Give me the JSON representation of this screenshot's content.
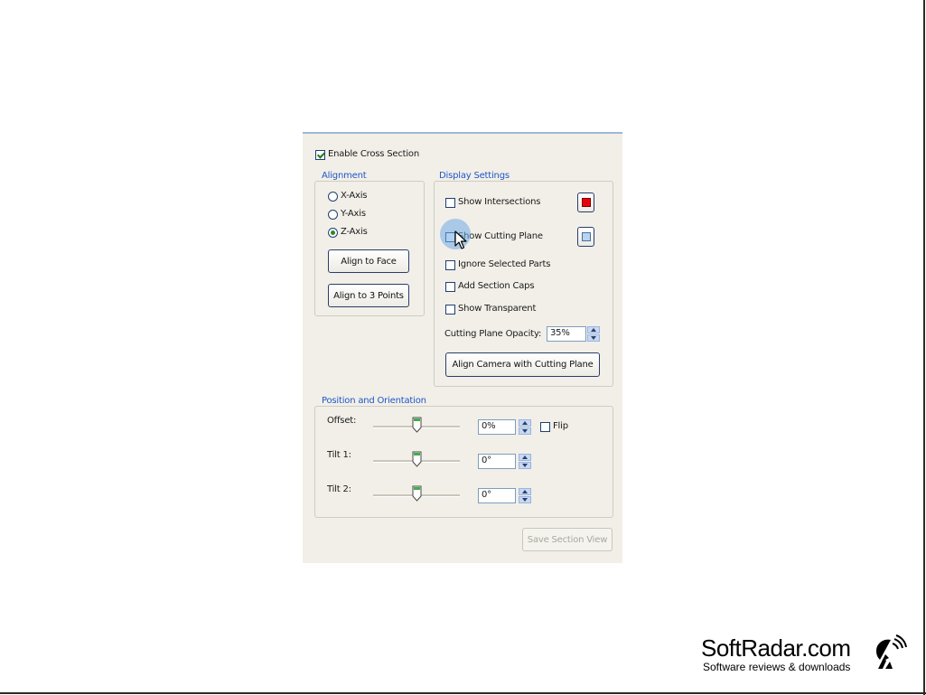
{
  "enable_cross_section": {
    "label": "Enable Cross Section",
    "checked": true
  },
  "alignment": {
    "title": "Alignment",
    "options": [
      {
        "label": "X-Axis",
        "selected": false
      },
      {
        "label": "Y-Axis",
        "selected": false
      },
      {
        "label": "Z-Axis",
        "selected": true
      }
    ],
    "align_to_face": "Align to Face",
    "align_to_3_points": "Align to 3 Points"
  },
  "display_settings": {
    "title": "Display Settings",
    "show_intersections": {
      "label": "Show Intersections",
      "checked": false,
      "color": "#e8000a"
    },
    "show_cutting_plane": {
      "label": "Show Cutting Plane",
      "checked": false,
      "color": "#b7d3f0"
    },
    "ignore_selected_parts": {
      "label": "Ignore Selected Parts",
      "checked": false
    },
    "add_section_caps": {
      "label": "Add Section Caps",
      "checked": false
    },
    "show_transparent": {
      "label": "Show Transparent",
      "checked": false
    },
    "opacity_label": "Cutting Plane Opacity:",
    "opacity_value": "35%",
    "align_camera": "Align Camera with Cutting Plane"
  },
  "position_orientation": {
    "title": "Position and Orientation",
    "offset": {
      "label": "Offset:",
      "value": "0%",
      "slider_fraction": 0.5
    },
    "flip": {
      "label": "Flip",
      "checked": false
    },
    "tilt1": {
      "label": "Tilt 1:",
      "value": "0°",
      "slider_fraction": 0.5
    },
    "tilt2": {
      "label": "Tilt 2:",
      "value": "0°",
      "slider_fraction": 0.5
    }
  },
  "save_section_view": "Save Section View",
  "watermark": {
    "site": "SoftRadar.com",
    "tagline": "Software reviews & downloads"
  }
}
